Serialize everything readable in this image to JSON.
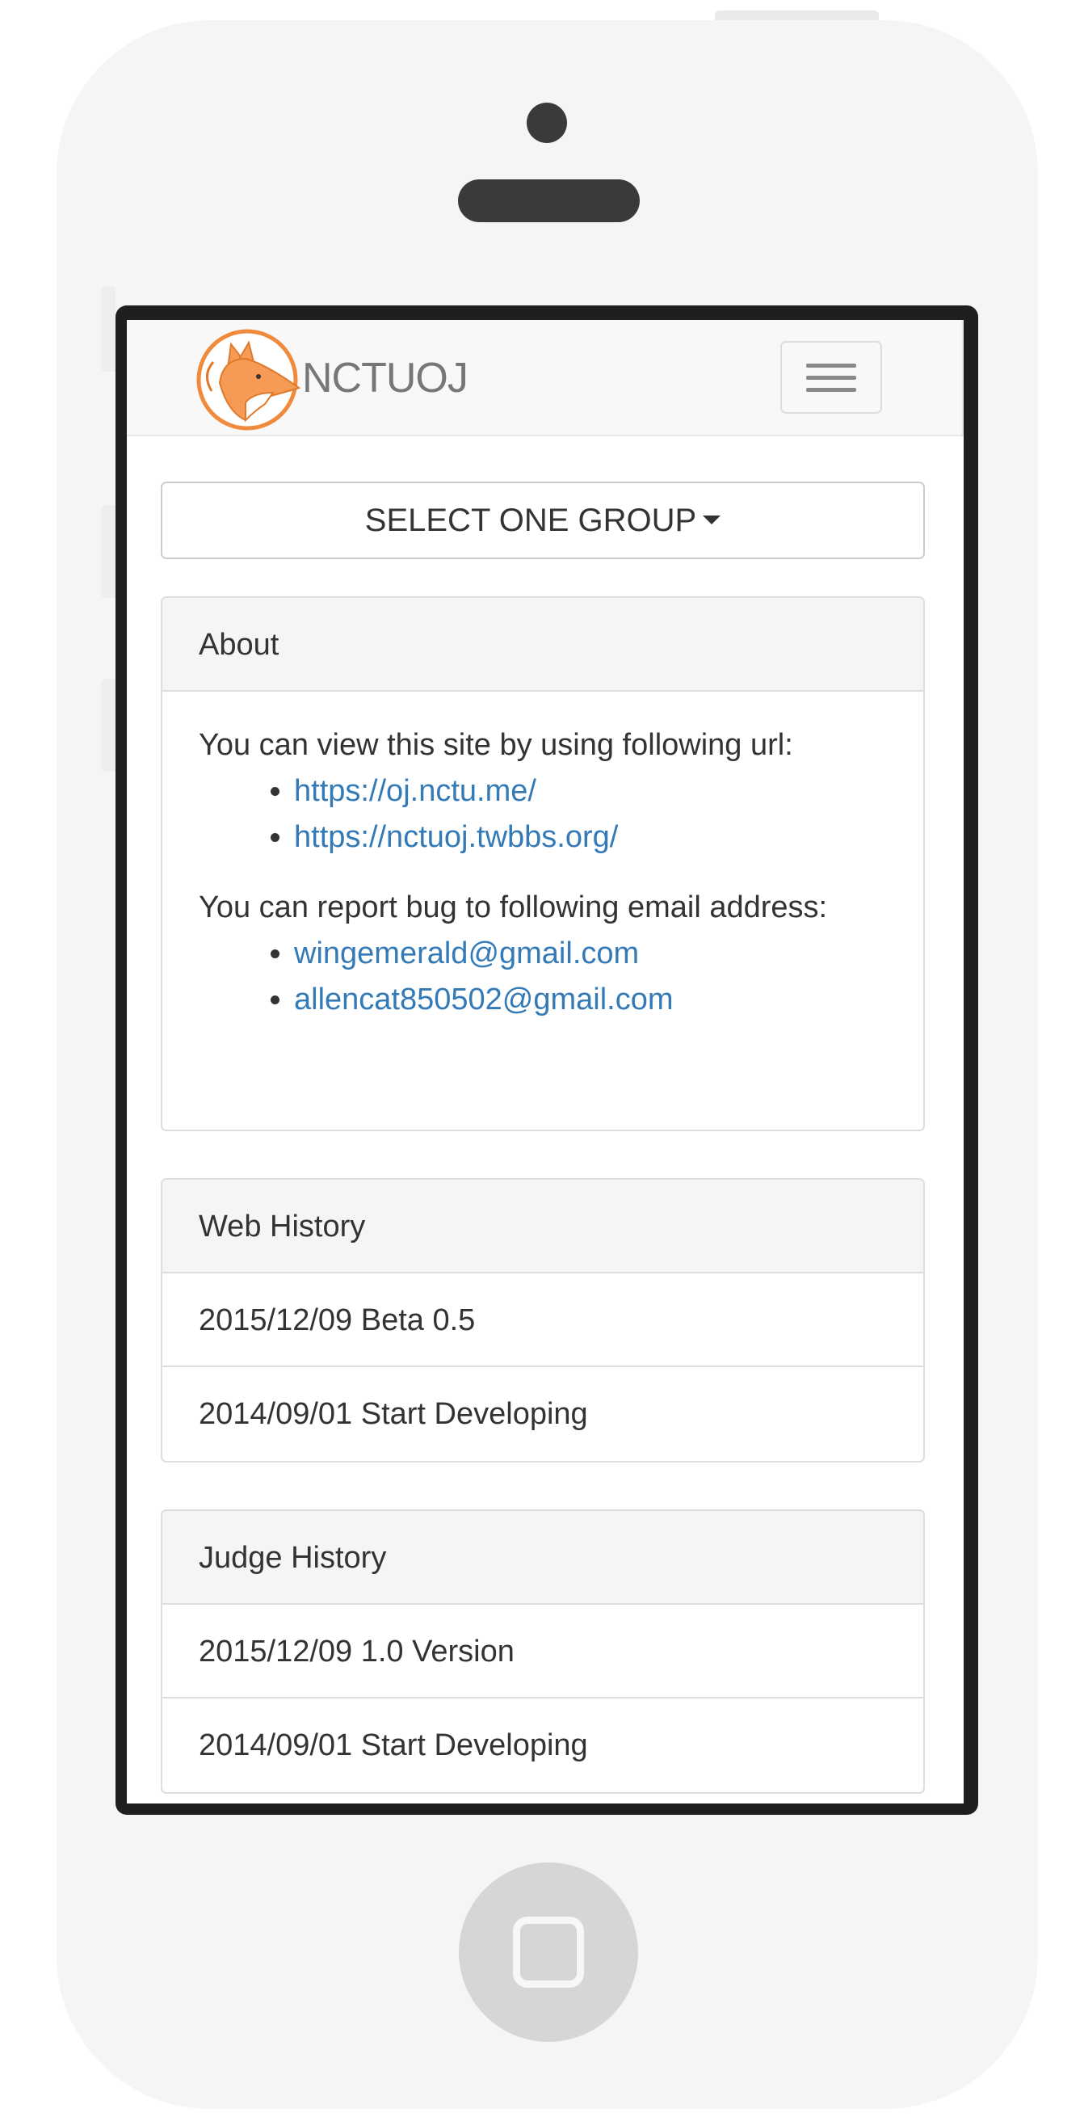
{
  "navbar": {
    "brand": "NCTUOJ",
    "logo_icon": "fox-logo-icon",
    "menu_icon": "hamburger-menu-icon"
  },
  "group_select": {
    "label": "SELECT ONE GROUP",
    "icon": "caret-down-icon"
  },
  "about": {
    "heading": "About",
    "url_intro": "You can view this site by using following url:",
    "urls": [
      "https://oj.nctu.me/",
      "https://nctuoj.twbbs.org/"
    ],
    "email_intro": "You can report bug to following email address:",
    "emails": [
      "wingemerald@gmail.com",
      "allencat850502@gmail.com"
    ]
  },
  "web_history": {
    "heading": "Web History",
    "items": [
      "2015/12/09 Beta 0.5",
      "2014/09/01 Start Developing"
    ]
  },
  "judge_history": {
    "heading": "Judge History",
    "items": [
      "2015/12/09 1.0 Version",
      "2014/09/01 Start Developing"
    ]
  },
  "colors": {
    "link": "#337ab7",
    "logo_accent": "#f08a3c",
    "panel_heading_bg": "#f5f5f5"
  }
}
